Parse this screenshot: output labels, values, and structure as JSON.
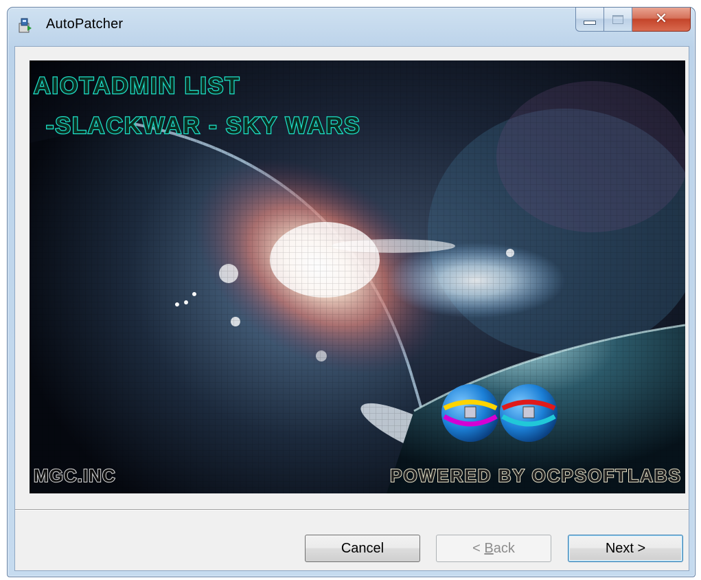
{
  "window": {
    "title": "AutoPatcher",
    "icon": "installer-icon",
    "controls": [
      "minimize-icon",
      "maximize-icon",
      "close-icon"
    ]
  },
  "banner": {
    "title_line1": "AIOTADMIN LIST",
    "title_line2": "-SLACKWAR - SKY WARS",
    "bottom_left": "MGC.INC",
    "bottom_right": "POWERED BY OCPSOFTLABS",
    "accent_color": "#1de0c8",
    "text_color": "#0a2f22"
  },
  "buttons": {
    "cancel": "Cancel",
    "back_prefix": "< ",
    "back_mnemonic": "B",
    "back_rest": "ack",
    "next": "Next >"
  }
}
